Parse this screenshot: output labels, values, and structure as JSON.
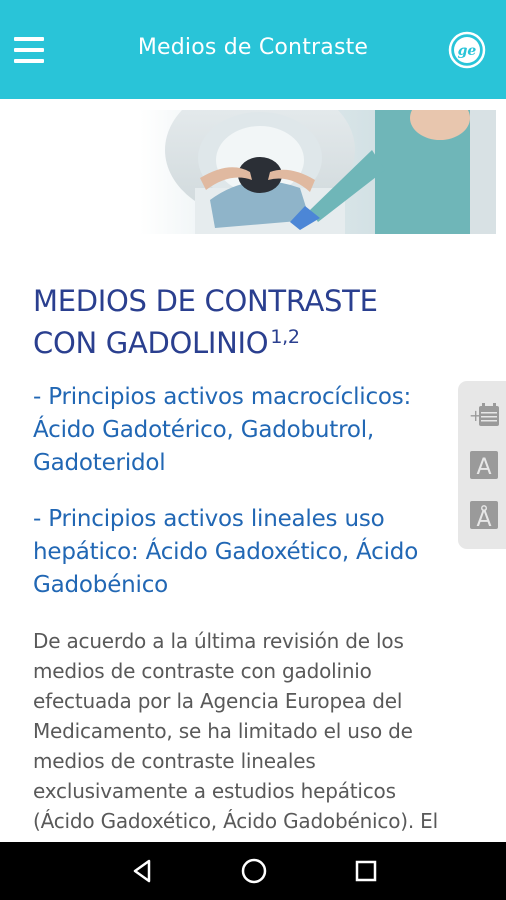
{
  "appbar": {
    "title": "Medios de Contraste",
    "menu_icon": "hamburger-menu-icon",
    "logo": "ge-logo"
  },
  "hero": {
    "description_icon": "mri-scan-photo"
  },
  "article": {
    "heading_line1": "MEDIOS DE CONTRASTE",
    "heading_line2": "CON GADOLINIO",
    "heading_sup": "1,2",
    "macro_line1": "- Principios activos macrocíclicos:",
    "macro_line2": "Ácido Gadotérico, Gadobutrol,",
    "macro_line3": "Gadoteridol",
    "lineal_line1": "- Principios activos lineales uso",
    "lineal_line2": "hepático: Ácido Gadoxético, Ácido",
    "lineal_line3": "Gadobénico",
    "body_lines": [
      "De acuerdo a la última revisión de los",
      "medios de contraste con gadolinio",
      "efectuada por la Agencia Europea del",
      "Medicamento, se ha limitado el uso de",
      "medios de contraste lineales",
      "exclusivamente a estudios hepáticos",
      "(Ácido Gadoxético, Ácido Gadobénico). El"
    ]
  },
  "side_tools": {
    "add_event_icon": "add-calendar-icon",
    "font_normal_label": "A",
    "font_large_label": "Å"
  },
  "system_nav": {
    "back_icon": "back-triangle-icon",
    "home_icon": "home-circle-icon",
    "recents_icon": "recents-square-icon"
  },
  "colors": {
    "appbar": "#29c4d8",
    "heading": "#2a3f8f",
    "subheading": "#2167b4",
    "body": "#595959",
    "navbar": "#000000"
  }
}
